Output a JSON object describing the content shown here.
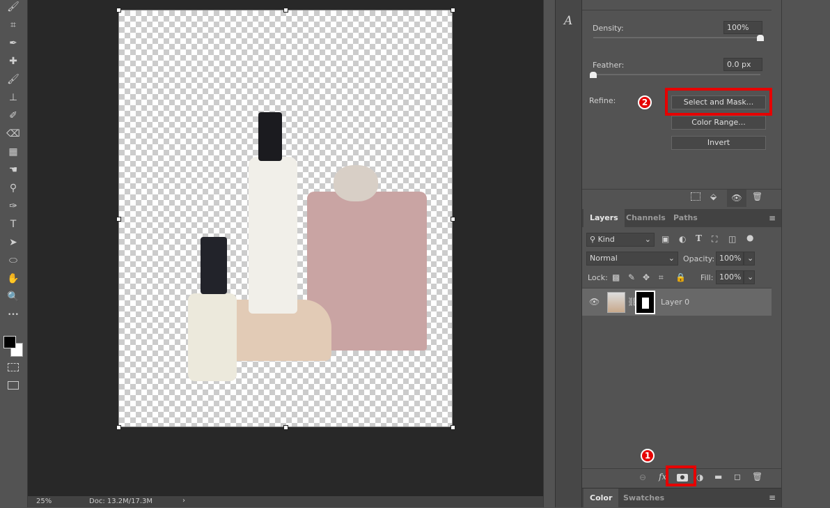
{
  "toolbar": {
    "tools": [
      "brush-icon",
      "crop-icon",
      "eyedropper-icon",
      "healing-icon",
      "brush-icon",
      "stamp-icon",
      "history-brush-icon",
      "eraser-icon",
      "gradient-icon",
      "smudge-icon",
      "dodge-icon",
      "pen-icon",
      "type-icon",
      "path-select-icon",
      "ellipse-icon",
      "hand-icon",
      "zoom-icon",
      "more-icon"
    ],
    "type_glyph": "T",
    "more_glyph": "•••"
  },
  "status": {
    "zoom": "25%",
    "doc": "Doc: 13.2M/17.3M",
    "arrow": "›"
  },
  "mini_panel": {
    "glyph": "A"
  },
  "properties": {
    "density_label": "Density:",
    "density_value": "100%",
    "density": 100,
    "feather_label": "Feather:",
    "feather_value": "0.0 px",
    "feather": 0,
    "refine_label": "Refine:",
    "select_mask": "Select and Mask...",
    "color_range": "Color Range...",
    "invert": "Invert",
    "step_badge": "2"
  },
  "layers": {
    "tabs": [
      "Layers",
      "Channels",
      "Paths"
    ],
    "filter": "Kind",
    "blend_mode": "Normal",
    "opacity_label": "Opacity:",
    "opacity": "100%",
    "lock_label": "Lock:",
    "fill_label": "Fill:",
    "fill": "100%",
    "items": [
      {
        "name": "Layer 0",
        "visible": true
      }
    ],
    "step_badge": "1"
  },
  "bottom_tabs": [
    "Color",
    "Swatches"
  ],
  "colors": {
    "highlight": "#e60000",
    "foreground": "#000000",
    "background": "#ffffff"
  }
}
